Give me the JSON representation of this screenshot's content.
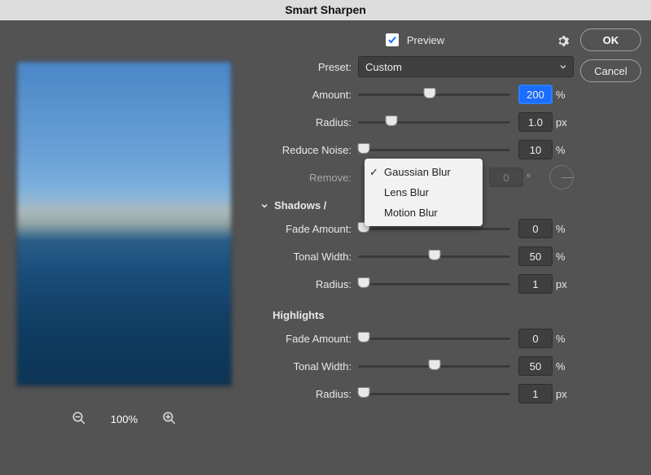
{
  "title": "Smart Sharpen",
  "buttons": {
    "ok": "OK",
    "cancel": "Cancel"
  },
  "preview_label": "Preview",
  "preview_checked": true,
  "preset": {
    "label": "Preset:",
    "value": "Custom"
  },
  "amount": {
    "label": "Amount:",
    "value": "200",
    "unit": "%",
    "pos": 47
  },
  "radius": {
    "label": "Radius:",
    "value": "1.0",
    "unit": "px",
    "pos": 22
  },
  "reduce_noise": {
    "label": "Reduce Noise:",
    "value": "10",
    "unit": "%",
    "pos": 4
  },
  "remove": {
    "label": "Remove:",
    "angle_value": "0",
    "angle_unit": "°",
    "options": [
      "Gaussian Blur",
      "Lens Blur",
      "Motion Blur"
    ],
    "selected_index": 0
  },
  "shadows_h": "Shadows /",
  "shadows": {
    "fade": {
      "label": "Fade Amount:",
      "value": "0",
      "unit": "%",
      "pos": 4
    },
    "tonal": {
      "label": "Tonal Width:",
      "value": "50",
      "unit": "%",
      "pos": 50
    },
    "radius": {
      "label": "Radius:",
      "value": "1",
      "unit": "px",
      "pos": 4
    }
  },
  "highlights_h": "Highlights",
  "highlights": {
    "fade": {
      "label": "Fade Amount:",
      "value": "0",
      "unit": "%",
      "pos": 4
    },
    "tonal": {
      "label": "Tonal Width:",
      "value": "50",
      "unit": "%",
      "pos": 50
    },
    "radius": {
      "label": "Radius:",
      "value": "1",
      "unit": "px",
      "pos": 4
    }
  },
  "zoom_level": "100%"
}
